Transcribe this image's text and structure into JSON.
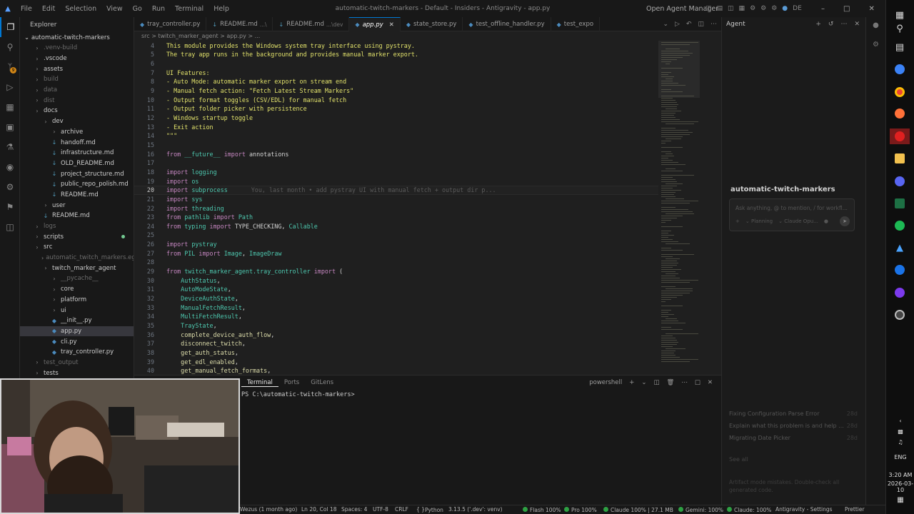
{
  "titlebar": {
    "menu": [
      "File",
      "Edit",
      "Selection",
      "View",
      "Go",
      "Run",
      "Terminal",
      "Help"
    ],
    "window_title": "automatic-twitch-markers - Default - Insiders - Antigravity - app.py",
    "open_agent_manager": "Open Agent Manager",
    "profile": "DE"
  },
  "explorer": {
    "header": "Explorer",
    "root": "automatic-twitch-markers",
    "items": [
      {
        "label": ".venv-build",
        "depth": 1,
        "type": "folder",
        "dim": true
      },
      {
        "label": ".vscode",
        "depth": 1,
        "type": "folder",
        "dim": false
      },
      {
        "label": "assets",
        "depth": 1,
        "type": "folder",
        "dim": false
      },
      {
        "label": "build",
        "depth": 1,
        "type": "folder",
        "dim": true
      },
      {
        "label": "data",
        "depth": 1,
        "type": "folder",
        "dim": true
      },
      {
        "label": "dist",
        "depth": 1,
        "type": "folder",
        "dim": true
      },
      {
        "label": "docs",
        "depth": 1,
        "type": "folder",
        "dim": false
      },
      {
        "label": "dev",
        "depth": 2,
        "type": "folder",
        "dim": false
      },
      {
        "label": "archive",
        "depth": 3,
        "type": "folder",
        "dim": false
      },
      {
        "label": "handoff.md",
        "depth": 3,
        "type": "md",
        "dim": false
      },
      {
        "label": "infrastructure.md",
        "depth": 3,
        "type": "md",
        "dim": false
      },
      {
        "label": "OLD_README.md",
        "depth": 3,
        "type": "md",
        "dim": false
      },
      {
        "label": "project_structure.md",
        "depth": 3,
        "type": "md",
        "dim": false
      },
      {
        "label": "public_repo_polish.md",
        "depth": 3,
        "type": "md",
        "dim": false
      },
      {
        "label": "README.md",
        "depth": 3,
        "type": "md",
        "dim": false
      },
      {
        "label": "user",
        "depth": 2,
        "type": "folder",
        "dim": false
      },
      {
        "label": "README.md",
        "depth": 2,
        "type": "md",
        "dim": false
      },
      {
        "label": "logs",
        "depth": 1,
        "type": "folder",
        "dim": true
      },
      {
        "label": "scripts",
        "depth": 1,
        "type": "folder",
        "dim": false,
        "modified": true
      },
      {
        "label": "src",
        "depth": 1,
        "type": "folder",
        "dim": false
      },
      {
        "label": "automatic_twitch_markers.egg-...",
        "depth": 2,
        "type": "folder",
        "dim": true
      },
      {
        "label": "twitch_marker_agent",
        "depth": 2,
        "type": "folder",
        "dim": false
      },
      {
        "label": "__pycache__",
        "depth": 3,
        "type": "folder",
        "dim": true
      },
      {
        "label": "core",
        "depth": 3,
        "type": "folder",
        "dim": false
      },
      {
        "label": "platform",
        "depth": 3,
        "type": "folder",
        "dim": false
      },
      {
        "label": "ui",
        "depth": 3,
        "type": "folder",
        "dim": false
      },
      {
        "label": "__init__.py",
        "depth": 3,
        "type": "py",
        "dim": false
      },
      {
        "label": "app.py",
        "depth": 3,
        "type": "py",
        "dim": false,
        "selected": true
      },
      {
        "label": "cli.py",
        "depth": 3,
        "type": "py",
        "dim": false
      },
      {
        "label": "tray_controller.py",
        "depth": 3,
        "type": "py",
        "dim": false
      },
      {
        "label": "test_output",
        "depth": 1,
        "type": "folder",
        "dim": true
      },
      {
        "label": "tests",
        "depth": 1,
        "type": "folder",
        "dim": false
      }
    ]
  },
  "tabs": [
    {
      "label": "tray_controller.py",
      "desc": "",
      "type": "py",
      "active": false
    },
    {
      "label": "README.md",
      "desc": "...\\",
      "type": "md",
      "active": false
    },
    {
      "label": "README.md",
      "desc": "...\\dev",
      "type": "md",
      "active": false
    },
    {
      "label": "app.py",
      "desc": "",
      "type": "py",
      "active": true
    },
    {
      "label": "state_store.py",
      "desc": "",
      "type": "py",
      "active": false
    },
    {
      "label": "test_offline_handler.py",
      "desc": "",
      "type": "py",
      "active": false
    },
    {
      "label": "test_expo",
      "desc": "",
      "type": "py",
      "active": false
    }
  ],
  "breadcrumb": "src > twitch_marker_agent > app.py > ...",
  "editor": {
    "current_line": 20,
    "blame": "You, last month • add pystray UI with manual fetch + output dir p...",
    "lines": [
      {
        "n": 4,
        "parts": [
          [
            "ds",
            "This module provides the Windows system tray interface using pystray."
          ]
        ]
      },
      {
        "n": 5,
        "parts": [
          [
            "ds",
            "The tray app runs in the background and provides manual marker export."
          ]
        ]
      },
      {
        "n": 6,
        "parts": []
      },
      {
        "n": 7,
        "parts": [
          [
            "ds",
            "UI Features:"
          ]
        ]
      },
      {
        "n": 8,
        "parts": [
          [
            "ds",
            "- Auto Mode: automatic marker export on stream end"
          ]
        ]
      },
      {
        "n": 9,
        "parts": [
          [
            "ds",
            "- Manual fetch action: \"Fetch Latest Stream Markers\""
          ]
        ]
      },
      {
        "n": 10,
        "parts": [
          [
            "ds",
            "- Output format toggles (CSV/EDL) for manual fetch"
          ]
        ]
      },
      {
        "n": 11,
        "parts": [
          [
            "ds",
            "- Output folder picker with persistence"
          ]
        ]
      },
      {
        "n": 12,
        "parts": [
          [
            "ds",
            "- Windows startup toggle"
          ]
        ]
      },
      {
        "n": 13,
        "parts": [
          [
            "ds",
            "- Exit action"
          ]
        ]
      },
      {
        "n": 14,
        "parts": [
          [
            "ds",
            "\"\"\""
          ]
        ]
      },
      {
        "n": 15,
        "parts": []
      },
      {
        "n": 16,
        "parts": [
          [
            "kw",
            "from"
          ],
          [
            "pl",
            " "
          ],
          [
            "mod",
            "__future__"
          ],
          [
            "pl",
            " "
          ],
          [
            "kw",
            "import"
          ],
          [
            "pl",
            " annotations"
          ]
        ]
      },
      {
        "n": 17,
        "parts": []
      },
      {
        "n": 18,
        "parts": [
          [
            "kw",
            "import"
          ],
          [
            "pl",
            " "
          ],
          [
            "mod",
            "logging"
          ]
        ]
      },
      {
        "n": 19,
        "parts": [
          [
            "kw",
            "import"
          ],
          [
            "pl",
            " "
          ],
          [
            "mod",
            "os"
          ]
        ]
      },
      {
        "n": 20,
        "parts": [
          [
            "kw",
            "import"
          ],
          [
            "pl",
            " "
          ],
          [
            "mod",
            "subprocess"
          ]
        ]
      },
      {
        "n": 21,
        "parts": [
          [
            "kw",
            "import"
          ],
          [
            "pl",
            " "
          ],
          [
            "mod",
            "sys"
          ]
        ]
      },
      {
        "n": 22,
        "parts": [
          [
            "kw",
            "import"
          ],
          [
            "pl",
            " "
          ],
          [
            "mod",
            "threading"
          ]
        ]
      },
      {
        "n": 23,
        "parts": [
          [
            "kw",
            "from"
          ],
          [
            "pl",
            " "
          ],
          [
            "mod",
            "pathlib"
          ],
          [
            "pl",
            " "
          ],
          [
            "kw",
            "import"
          ],
          [
            "pl",
            " "
          ],
          [
            "mod",
            "Path"
          ]
        ]
      },
      {
        "n": 24,
        "parts": [
          [
            "kw",
            "from"
          ],
          [
            "pl",
            " "
          ],
          [
            "mod",
            "typing"
          ],
          [
            "pl",
            " "
          ],
          [
            "kw",
            "import"
          ],
          [
            "pl",
            " TYPE_CHECKING, "
          ],
          [
            "mod",
            "Callable"
          ]
        ]
      },
      {
        "n": 25,
        "parts": []
      },
      {
        "n": 26,
        "parts": [
          [
            "kw",
            "import"
          ],
          [
            "pl",
            " "
          ],
          [
            "mod",
            "pystray"
          ]
        ]
      },
      {
        "n": 27,
        "parts": [
          [
            "kw",
            "from"
          ],
          [
            "pl",
            " "
          ],
          [
            "mod",
            "PIL"
          ],
          [
            "pl",
            " "
          ],
          [
            "kw",
            "import"
          ],
          [
            "pl",
            " "
          ],
          [
            "mod",
            "Image"
          ],
          [
            "pl",
            ", "
          ],
          [
            "mod",
            "ImageDraw"
          ]
        ]
      },
      {
        "n": 28,
        "parts": []
      },
      {
        "n": 29,
        "parts": [
          [
            "kw",
            "from"
          ],
          [
            "pl",
            " "
          ],
          [
            "mod",
            "twitch_marker_agent.tray_controller"
          ],
          [
            "pl",
            " "
          ],
          [
            "kw",
            "import"
          ],
          [
            "pl",
            " ("
          ]
        ]
      },
      {
        "n": 30,
        "parts": [
          [
            "pl",
            "    "
          ],
          [
            "mod",
            "AuthStatus"
          ],
          [
            "pl",
            ","
          ]
        ]
      },
      {
        "n": 31,
        "parts": [
          [
            "pl",
            "    "
          ],
          [
            "mod",
            "AutoModeState"
          ],
          [
            "pl",
            ","
          ]
        ]
      },
      {
        "n": 32,
        "parts": [
          [
            "pl",
            "    "
          ],
          [
            "mod",
            "DeviceAuthState"
          ],
          [
            "pl",
            ","
          ]
        ]
      },
      {
        "n": 33,
        "parts": [
          [
            "pl",
            "    "
          ],
          [
            "mod",
            "ManualFetchResult"
          ],
          [
            "pl",
            ","
          ]
        ]
      },
      {
        "n": 34,
        "parts": [
          [
            "pl",
            "    "
          ],
          [
            "mod",
            "MultiFetchResult"
          ],
          [
            "pl",
            ","
          ]
        ]
      },
      {
        "n": 35,
        "parts": [
          [
            "pl",
            "    "
          ],
          [
            "mod",
            "TrayState"
          ],
          [
            "pl",
            ","
          ]
        ]
      },
      {
        "n": 36,
        "parts": [
          [
            "pl",
            "    "
          ],
          [
            "fn",
            "complete_device_auth_flow"
          ],
          [
            "pl",
            ","
          ]
        ]
      },
      {
        "n": 37,
        "parts": [
          [
            "pl",
            "    "
          ],
          [
            "fn",
            "disconnect_twitch"
          ],
          [
            "pl",
            ","
          ]
        ]
      },
      {
        "n": 38,
        "parts": [
          [
            "pl",
            "    "
          ],
          [
            "fn",
            "get_auth_status"
          ],
          [
            "pl",
            ","
          ]
        ]
      },
      {
        "n": 39,
        "parts": [
          [
            "pl",
            "    "
          ],
          [
            "fn",
            "get_edl_enabled"
          ],
          [
            "pl",
            ","
          ]
        ]
      },
      {
        "n": 40,
        "parts": [
          [
            "pl",
            "    "
          ],
          [
            "fn",
            "get_manual_fetch_formats"
          ],
          [
            "pl",
            ","
          ]
        ]
      }
    ]
  },
  "panel": {
    "tabs": [
      "Problems",
      "Output",
      "Debug Console",
      "Terminal",
      "Ports",
      "GitLens"
    ],
    "active_tab": "Terminal",
    "shell": "powershell",
    "prompt": "PS C:\\automatic-twitch-markers>"
  },
  "agent": {
    "header": "Agent",
    "project": "automatic-twitch-markers",
    "input_placeholder": "Ask anything, @ to mention, / for workfl...",
    "mode": "Planning",
    "model": "Claude Opu...",
    "conversations": [
      {
        "title": "Fixing Configuration Parse Error",
        "age": "28d"
      },
      {
        "title": "Explain what this problem is and help ...",
        "age": "28d"
      },
      {
        "title": "Migrating Date Picker",
        "age": "28d"
      }
    ],
    "see_all": "See all",
    "hint": "Artifact mode mistakes. Double-check all generated code."
  },
  "statusbar": {
    "blame": "Wezus (1 month ago)",
    "position": "Ln 20, Col 18",
    "spaces": "Spaces: 4",
    "encoding": "UTF-8",
    "eol": "CRLF",
    "language": "Python",
    "interpreter": "3.13.5 ('.dev': venv)",
    "flash": "Flash 100%",
    "pro": "Pro 100%",
    "claude1": "Claude 100% | 27.1 MB",
    "gemini": "Gemini: 100%",
    "claude2": "Claude: 100%",
    "settings": "Antigravity - Settings",
    "prettier": "Prettier"
  },
  "taskbar": {
    "time": "3:20 AM",
    "date": "2026-03-10",
    "lang": "ENG"
  },
  "colors": {
    "accent": "#0078d4",
    "docstring": "#e2e26b",
    "keyword": "#c586c0",
    "module": "#4ec9b0",
    "status_ok": "#2ea043"
  }
}
